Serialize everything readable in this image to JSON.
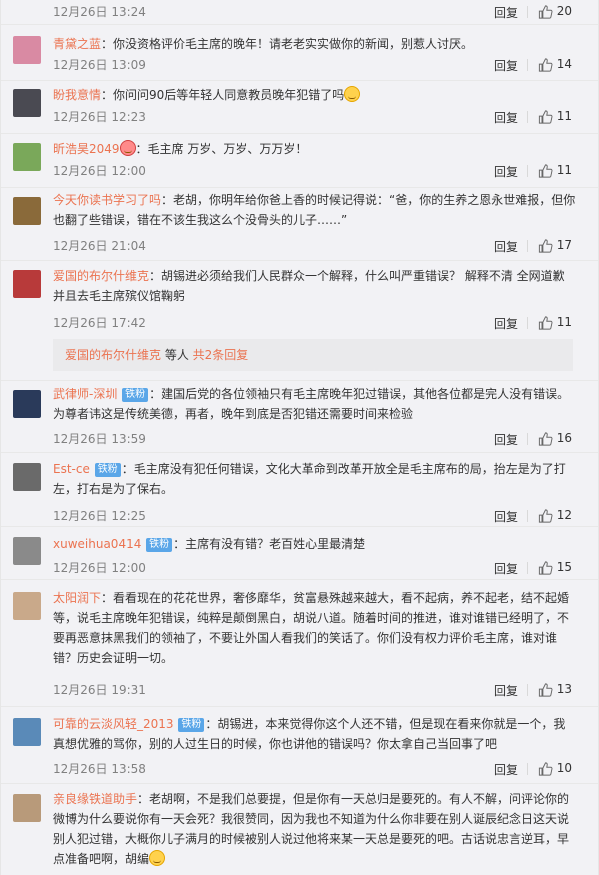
{
  "header": {
    "time": "12月26日 13:24",
    "reply": "回复",
    "likes": "20"
  },
  "comments": [
    {
      "user": "青黛之蓝",
      "text": "：你没资格评价毛主席的晚年！请老老实实做你的新闻，别惹人讨厌。",
      "time": "12月26日 13:09",
      "reply": "回复",
      "likes": "14",
      "avatar_color": "#d98aa3"
    },
    {
      "user": "盼我意情",
      "text": "：你问问90后等年轻人同意教员晚年犯错了吗",
      "time": "12月26日 12:23",
      "reply": "回复",
      "likes": "11",
      "avatar_color": "#4a4a52"
    },
    {
      "user": "昕浩昊2049",
      "text": "：毛主席 万岁、万岁、万万岁！",
      "time": "12月26日 12:00",
      "reply": "回复",
      "likes": "11",
      "avatar_color": "#7aa85a"
    },
    {
      "user": "今天你读书学习了吗",
      "text": "：老胡，你明年给你爸上香的时候记得说：“爸，你的生养之恩永世难报，但你也翻了些错误，错在不该生我这么个没骨头的儿子……”",
      "time": "12月26日 21:04",
      "reply": "回复",
      "likes": "17",
      "avatar_color": "#8a6a3a"
    },
    {
      "user": "爱国的布尔什维克",
      "text": "：胡锡进必须给我们人民群众一个解释，什么叫严重错误？ 解释不清 全网道歉并且去毛主席殡仪馆鞠躬",
      "time": "12月26日 17:42",
      "reply": "回复",
      "likes": "11",
      "avatar_color": "#b83a3a"
    },
    {
      "user": "武律师-深圳",
      "badge": "铁粉",
      "text": "：建国后党的各位领袖只有毛主席晚年犯过错误，其他各位都是完人没有错误。为尊者讳这是传统美德，再者，晚年到底是否犯错还需要时间来检验",
      "time": "12月26日 13:59",
      "reply": "回复",
      "likes": "16",
      "avatar_color": "#2a3a5a"
    },
    {
      "user": "Est-ce",
      "badge": "铁粉",
      "text": "：毛主席没有犯任何错误，文化大革命到改革开放全是毛主席布的局，抬左是为了打左，打右是为了保右。",
      "time": "12月26日 12:25",
      "reply": "回复",
      "likes": "12",
      "avatar_color": "#6a6a6a"
    },
    {
      "user": "xuweihua0414",
      "badge": "铁粉",
      "text": "：主席有没有错？老百姓心里最清楚",
      "time": "12月26日 12:00",
      "reply": "回复",
      "likes": "15",
      "avatar_color": "#8a8a8a"
    },
    {
      "user": "太阳润下",
      "text": "：看看现在的花花世界，奢侈靡华，贫富悬殊越来越大，看不起病，养不起老，结不起婚等，说毛主席晚年犯错误，纯粹是颠倒黑白，胡说八道。随着时间的推进，谁对谁错已经明了，不要再恶意抹黑我们的领袖了，不要让外国人看我们的笑话了。你们没有权力评价毛主席，谁对谁错？历史会证明一切。",
      "time": "12月26日 19:31",
      "reply": "回复",
      "likes": "13",
      "avatar_color": "#c9a98a"
    },
    {
      "user": "可靠的云淡风轻_2013",
      "badge": "铁粉",
      "text": "：胡锡进，本来觉得你这个人还不错，但是现在看来你就是一个，我真想优雅的骂你，别的人过生日的时候，你也讲他的错误吗？你太拿自己当回事了吧",
      "time": "12月26日 13:58",
      "reply": "回复",
      "likes": "10",
      "avatar_color": "#5a8ab8"
    },
    {
      "user": "亲良缘铁道助手",
      "text": "：老胡啊，不是我们总要提，但是你有一天总归是要死的。有人不解，问评论你的微博为什么要说你有一天会死？我很赞同，因为我也不知道为什么你非要在别人诞辰纪念日这天说别人犯过错，大概你儿子满月的时候被别人说过他将来某一天总是要死的吧。古话说忠言逆耳，早点准备吧啊，胡编",
      "time": "",
      "reply": "",
      "likes": "",
      "avatar_color": "#b89a7a"
    }
  ],
  "subreply": {
    "user": "爱国的布尔什维克",
    "mid": " 等人 ",
    "count": "共2条回复"
  },
  "colors": {
    "username": "#eb7350",
    "meta": "#808080",
    "badge": "#5aa6e8",
    "background": "#f2f2f5"
  },
  "icons": {
    "like": "thumbs-up-icon",
    "emoji": "smile-emoji-icon"
  }
}
